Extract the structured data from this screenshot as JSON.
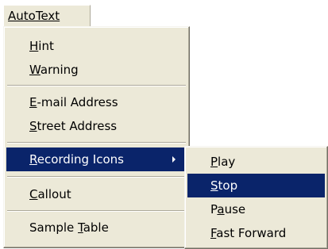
{
  "menubar": {
    "title": "AutoText"
  },
  "menu": {
    "items": [
      {
        "pre": "",
        "key": "H",
        "post": "int"
      },
      {
        "pre": "",
        "key": "W",
        "post": "arning"
      },
      {
        "pre": "",
        "key": "E",
        "post": "-mail Address"
      },
      {
        "pre": "",
        "key": "S",
        "post": "treet Address"
      },
      {
        "pre": "",
        "key": "R",
        "post": "ecording Icons"
      },
      {
        "pre": "",
        "key": "C",
        "post": "allout"
      },
      {
        "pre": "Sample ",
        "key": "T",
        "post": "able"
      }
    ]
  },
  "submenu": {
    "items": [
      {
        "pre": "",
        "key": "P",
        "post": "lay"
      },
      {
        "pre": "",
        "key": "S",
        "post": "top"
      },
      {
        "pre": "P",
        "key": "a",
        "post": "use"
      },
      {
        "pre": "",
        "key": "F",
        "post": "ast Forward"
      }
    ]
  },
  "state": {
    "highlighted_menu_item": "Recording Icons",
    "highlighted_submenu_item": "Stop"
  },
  "colors": {
    "menu_background": "#ece9d8",
    "highlight": "#0a246a",
    "highlight_text": "#ffffff"
  }
}
